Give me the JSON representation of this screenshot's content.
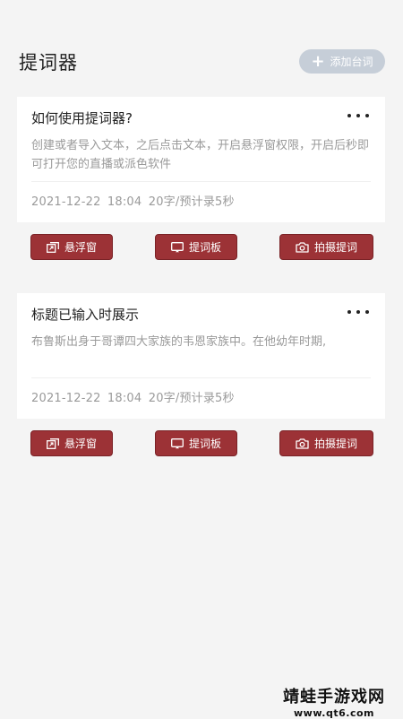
{
  "header": {
    "title": "提词器",
    "add_label": "添加台词"
  },
  "cards": [
    {
      "title": "如何使用提词器?",
      "description": "创建或者导入文本，之后点击文本，开启悬浮窗权限，开启后秒即可打开您的直播或派色软件",
      "date": "2021-12-22",
      "time": "18:04",
      "stats": "20字/预计录5秒"
    },
    {
      "title": "标题已输入时展示",
      "description": "布鲁斯出身于哥谭四大家族的韦恩家族中。在他幼年时期,",
      "date": "2021-12-22",
      "time": "18:04",
      "stats": "20字/预计录5秒"
    }
  ],
  "actions": {
    "float_window": "悬浮窗",
    "prompt_board": "提词板",
    "shoot_prompt": "拍摄提词"
  },
  "watermark": {
    "name": "靖蛙手游戏网",
    "url": "www.qt6.com"
  }
}
